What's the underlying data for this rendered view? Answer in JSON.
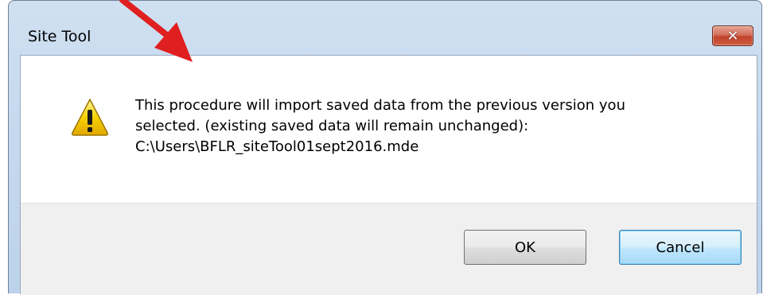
{
  "window": {
    "title": "Site Tool",
    "close_symbol": "✕"
  },
  "message": {
    "line1": "This procedure will import saved data from the previous version you",
    "line2": "selected.  (existing saved data will remain unchanged):",
    "line3": "C:\\Users\\BFLR_siteTool01sept2016.mde",
    "icon": "warning-icon"
  },
  "buttons": {
    "ok_label": "OK",
    "cancel_label": "Cancel"
  },
  "colors": {
    "annotation_arrow": "#e02020",
    "warning_fill": "#f5c400"
  }
}
